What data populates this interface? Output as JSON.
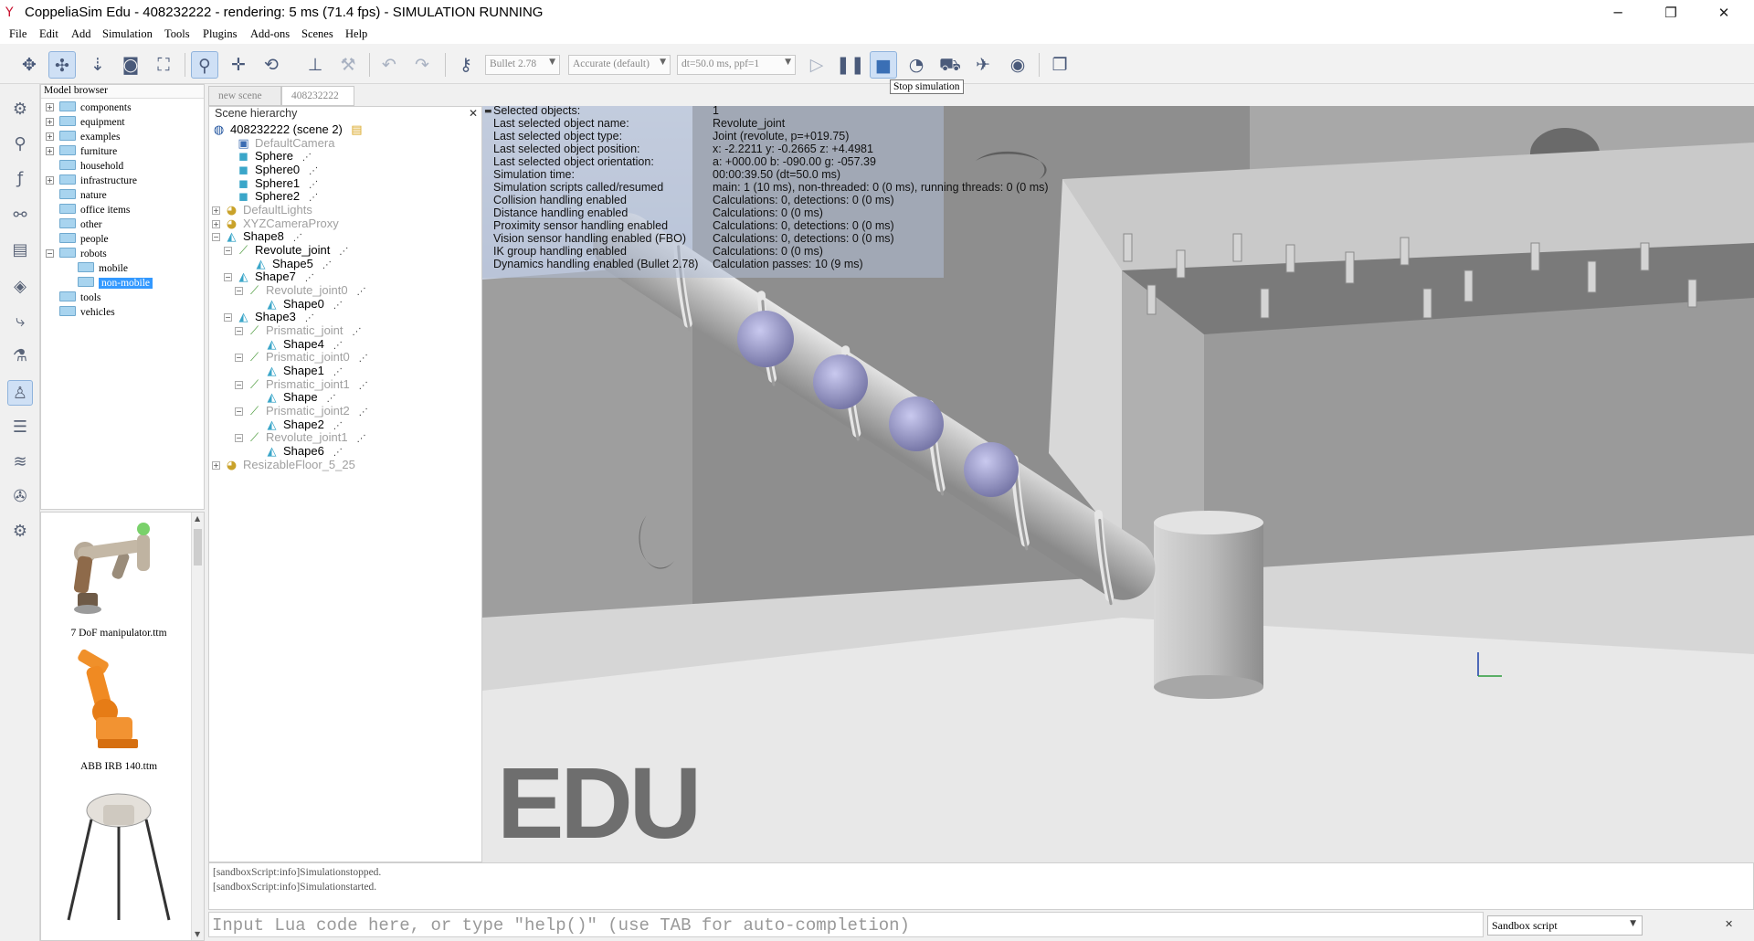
{
  "window": {
    "title": "CoppeliaSim Edu - 408232222 - rendering: 5 ms (71.4 fps) - SIMULATION RUNNING",
    "minimize": "─",
    "restore": "❐",
    "close": "✕"
  },
  "menu": [
    "File",
    "Edit",
    "Add",
    "Simulation",
    "Tools",
    "Plugins",
    "Add-ons",
    "Scenes",
    "Help"
  ],
  "toolbar": {
    "engine": "Bullet 2.78",
    "accuracy": "Accurate (default)",
    "timestep": "dt=50.0 ms, ppf=1",
    "tooltip": "Stop simulation"
  },
  "model_browser": {
    "title": "Model browser",
    "folders": [
      {
        "label": "components"
      },
      {
        "label": "equipment"
      },
      {
        "label": "examples"
      },
      {
        "label": "furniture"
      },
      {
        "label": "household"
      },
      {
        "label": "infrastructure"
      },
      {
        "label": "nature"
      },
      {
        "label": "office items"
      },
      {
        "label": "other"
      },
      {
        "label": "people"
      },
      {
        "label": "robots"
      },
      {
        "label": "mobile"
      },
      {
        "label": "non-mobile"
      },
      {
        "label": "tools"
      },
      {
        "label": "vehicles"
      }
    ],
    "thumbnails": [
      {
        "label": "7 DoF manipulator.ttm"
      },
      {
        "label": "ABB IRB 140.ttm"
      }
    ]
  },
  "scene_tabs": [
    "new scene",
    "408232222"
  ],
  "hierarchy": {
    "title": "Scene hierarchy",
    "nodes": [
      "408232222 (scene 2)",
      "DefaultCamera",
      "Sphere",
      "Sphere0",
      "Sphere1",
      "Sphere2",
      "DefaultLights",
      "XYZCameraProxy",
      "Shape8",
      "Revolute_joint",
      "Shape5",
      "Shape7",
      "Revolute_joint0",
      "Shape0",
      "Shape3",
      "Prismatic_joint",
      "Shape4",
      "Prismatic_joint0",
      "Shape1",
      "Prismatic_joint1",
      "Shape",
      "Prismatic_joint2",
      "Shape2",
      "Revolute_joint1",
      "Shape6",
      "ResizableFloor_5_25"
    ]
  },
  "info": {
    "labels": [
      "Selected objects:",
      "Last selected object name:",
      "Last selected object type:",
      "Last selected object position:",
      "Last selected object orientation:",
      "Simulation time:",
      "Simulation scripts called/resumed",
      "Collision handling enabled",
      "Distance handling enabled",
      "Proximity sensor handling enabled",
      "Vision sensor handling enabled (FBO)",
      "IK group handling enabled",
      "Dynamics handling enabled (Bullet 2.78)"
    ],
    "values": [
      "1",
      "Revolute_joint",
      "Joint (revolute, p=+019.75)",
      "x: -2.2211    y: -0.2665    z: +4.4981",
      "a: +000.00    b: -090.00    g: -057.39",
      "00:00:39.50 (dt=50.0 ms)",
      "main: 1 (10 ms), non-threaded: 0 (0 ms), running threads: 0 (0 ms)",
      "Calculations: 0, detections: 0 (0 ms)",
      "Calculations: 0 (0 ms)",
      "Calculations: 0, detections: 0 (0 ms)",
      "Calculations: 0, detections: 0 (0 ms)",
      "Calculations: 0 (0 ms)",
      "Calculation passes: 10 (9 ms)"
    ],
    "collapse_glyph": "▬"
  },
  "watermark": "EDU",
  "console": {
    "lines": [
      "[sandboxScript:info]Simulationstopped.",
      "[sandboxScript:info]Simulationstarted."
    ],
    "input_placeholder": "Input Lua code here, or type \"help()\" (use TAB for auto-completion)",
    "script_selector": "Sandbox script",
    "close": "✕"
  },
  "colors": {
    "selection": "#fbd466",
    "accent": "#3399ff",
    "overlay": "#b0bed6"
  }
}
